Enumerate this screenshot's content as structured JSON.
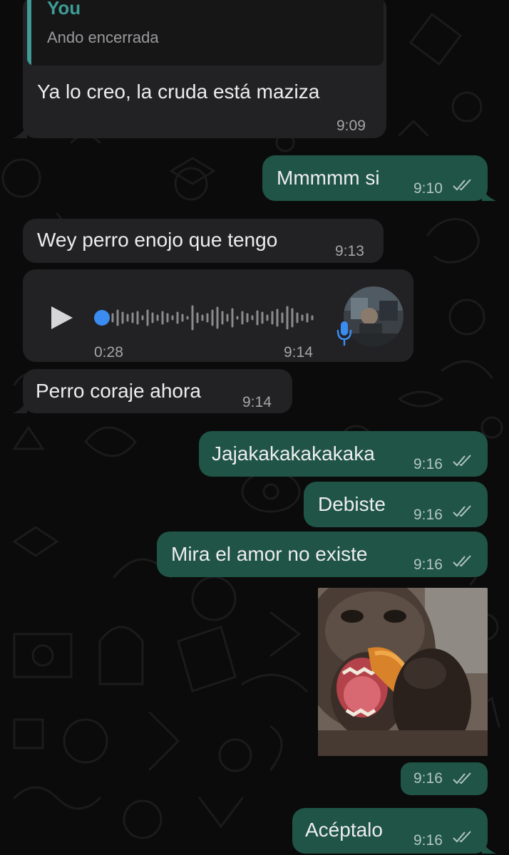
{
  "colors": {
    "background": "#0b0b0b",
    "incoming_bubble": "#222224",
    "outgoing_bubble": "#1f5446",
    "quote_accent": "#3e9b95",
    "voice_accent": "#3b8cf0"
  },
  "messages": [
    {
      "direction": "incoming",
      "type": "reply",
      "quote": {
        "author": "You",
        "text": "Ando encerrada"
      },
      "text": "Ya lo creo, la cruda está maziza",
      "time": "9:09"
    },
    {
      "direction": "outgoing",
      "type": "text",
      "text": "Mmmmm si",
      "time": "9:10",
      "status": "read-ticks-icon"
    },
    {
      "direction": "incoming",
      "type": "text",
      "text": "Wey perro enojo que tengo",
      "time": "9:13"
    },
    {
      "direction": "incoming",
      "type": "voice",
      "duration": "0:28",
      "time": "9:14",
      "icons": {
        "play": "play-icon",
        "mic": "microphone-icon"
      }
    },
    {
      "direction": "incoming",
      "type": "text",
      "text": "Perro coraje ahora",
      "time": "9:14"
    },
    {
      "direction": "outgoing",
      "type": "text",
      "text": "Jajakakakakakaka",
      "time": "9:16",
      "status": "read-ticks-icon"
    },
    {
      "direction": "outgoing",
      "type": "text",
      "text": "Debiste",
      "time": "9:16",
      "status": "read-ticks-icon"
    },
    {
      "direction": "outgoing",
      "type": "text",
      "text": "Mira el amor no existe",
      "time": "9:16",
      "status": "read-ticks-icon"
    },
    {
      "direction": "outgoing",
      "type": "image",
      "image": "monkey-eating-mango-photo",
      "time": "9:16",
      "status": "read-ticks-icon"
    },
    {
      "direction": "outgoing",
      "type": "text",
      "text": "Acéptalo",
      "time": "9:16",
      "status": "read-ticks-icon"
    }
  ]
}
